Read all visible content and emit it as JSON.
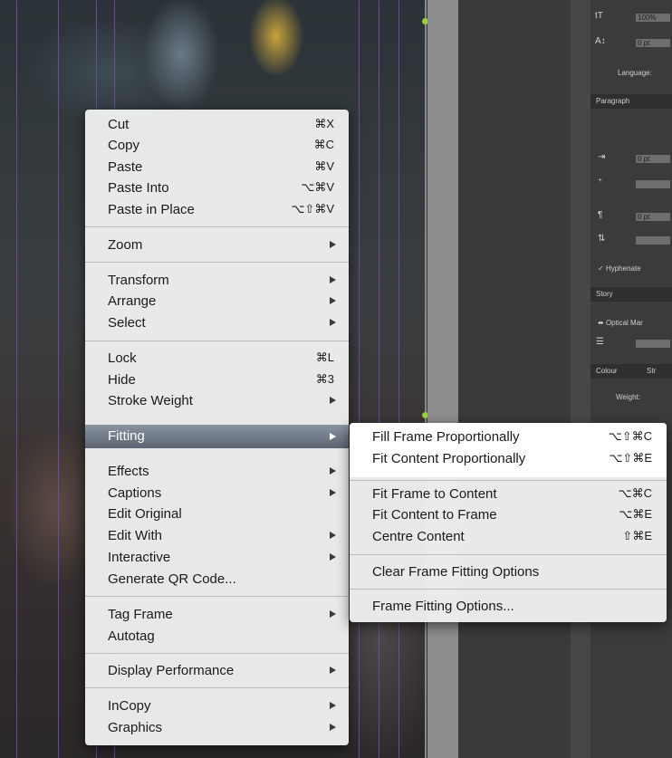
{
  "context_menu": {
    "items": [
      {
        "label": "Cut",
        "shortcut": "⌘X"
      },
      {
        "label": "Copy",
        "shortcut": "⌘C"
      },
      {
        "label": "Paste",
        "shortcut": "⌘V"
      },
      {
        "label": "Paste Into",
        "shortcut": "⌥⌘V"
      },
      {
        "label": "Paste in Place",
        "shortcut": "⌥⇧⌘V"
      },
      {
        "label": "Zoom"
      },
      {
        "label": "Transform"
      },
      {
        "label": "Arrange"
      },
      {
        "label": "Select"
      },
      {
        "label": "Lock",
        "shortcut": "⌘L"
      },
      {
        "label": "Hide",
        "shortcut": "⌘3"
      },
      {
        "label": "Stroke Weight"
      },
      {
        "label": "Fitting"
      },
      {
        "label": "Effects"
      },
      {
        "label": "Captions"
      },
      {
        "label": "Edit Original"
      },
      {
        "label": "Edit With"
      },
      {
        "label": "Interactive"
      },
      {
        "label": "Generate QR Code..."
      },
      {
        "label": "Tag Frame"
      },
      {
        "label": "Autotag"
      },
      {
        "label": "Display Performance"
      },
      {
        "label": "InCopy"
      },
      {
        "label": "Graphics"
      }
    ]
  },
  "fitting_submenu": {
    "items": [
      {
        "label": "Fill Frame Proportionally",
        "shortcut": "⌥⇧⌘C"
      },
      {
        "label": "Fit Content Proportionally",
        "shortcut": "⌥⇧⌘E"
      },
      {
        "label": "Fit Frame to Content",
        "shortcut": "⌥⌘C"
      },
      {
        "label": "Fit Content to Frame",
        "shortcut": "⌥⌘E"
      },
      {
        "label": "Centre Content",
        "shortcut": "⇧⌘E"
      },
      {
        "label": "Clear Frame Fitting Options"
      },
      {
        "label": "Frame Fitting Options..."
      }
    ]
  },
  "panel": {
    "language_label": "Language:",
    "paragraph_tab": "Paragraph",
    "hyphenate_label": "Hyphenate",
    "story_tab": "Story",
    "optical_label": "Optical Mar",
    "colour_tab": "Colour",
    "colour_tab2": "Str",
    "weight_label": "Weight:",
    "scale_value": "100%",
    "field_value": "0 pt",
    "check_glyph": "✓",
    "optical_glyph": "⬌",
    "font_size_icon": "tT",
    "baseline_icon": "A↕",
    "align_icon": "⊏",
    "indent_icon": "⇥",
    "drop_icon": "⁺",
    "ruler_icon": "¶",
    "spacer_icon": "⇅",
    "story_icon": "☰"
  },
  "colors": {
    "guide": "#7a4ab8",
    "handle": "#9bd03a",
    "highlight": "#5c6573"
  }
}
